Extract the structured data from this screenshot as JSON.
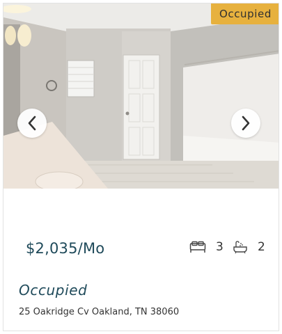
{
  "listing": {
    "badge": "Occupied",
    "price": "$2,035/Mo",
    "beds": "3",
    "baths": "2",
    "status": "Occupied",
    "address": "25 Oakridge Cv Oakland, TN 38060"
  },
  "icons": {
    "prev": "chevron-left-icon",
    "next": "chevron-right-icon",
    "beds": "bed-icon",
    "baths": "bathtub-icon"
  },
  "colors": {
    "badge_bg": "#e7b13e",
    "accent_text": "#1f4a5a"
  }
}
